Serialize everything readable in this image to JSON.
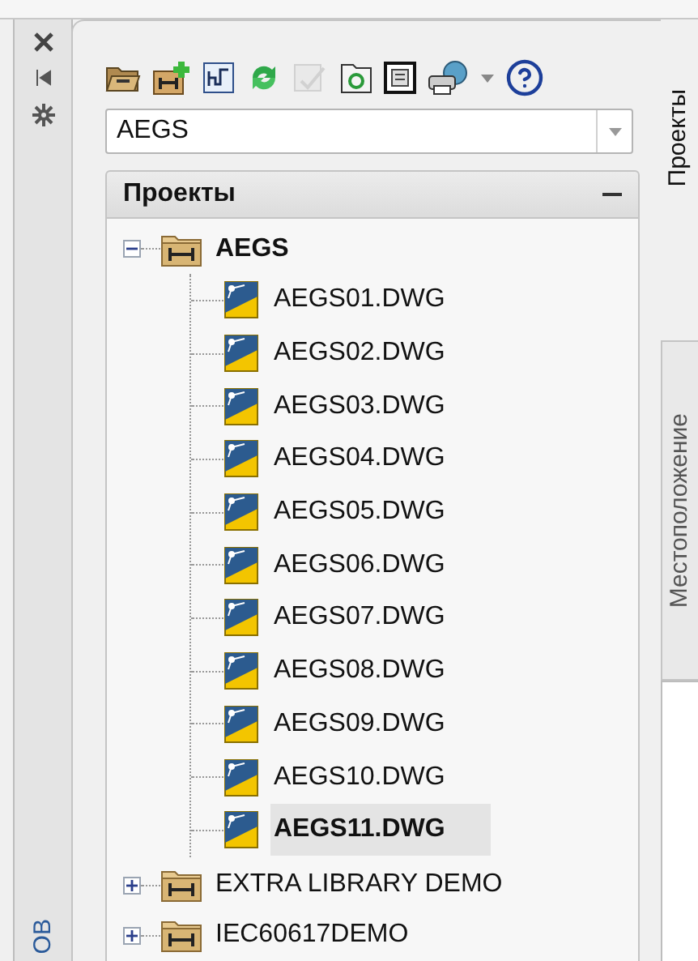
{
  "dock_strip": {
    "label": "ОВ"
  },
  "toolbar": {
    "buttons": [
      {
        "kind": "open-project",
        "disabled": false
      },
      {
        "kind": "new-project",
        "disabled": false
      },
      {
        "kind": "properties",
        "disabled": false
      },
      {
        "kind": "refresh",
        "disabled": false
      },
      {
        "kind": "task-list",
        "disabled": true
      },
      {
        "kind": "folder-refresh",
        "disabled": false
      },
      {
        "kind": "report",
        "disabled": false
      },
      {
        "kind": "publish",
        "disabled": false
      },
      {
        "kind": "dropdown",
        "disabled": false
      },
      {
        "kind": "help",
        "disabled": false
      }
    ]
  },
  "project_combo": {
    "value": "AEGS"
  },
  "section": {
    "title": "Проекты",
    "expanded": true
  },
  "tree": [
    {
      "label": "AEGS",
      "active": true,
      "expanded": true,
      "children": [
        {
          "label": "AEGS01.DWG",
          "selected": false
        },
        {
          "label": "AEGS02.DWG",
          "selected": false
        },
        {
          "label": "AEGS03.DWG",
          "selected": false
        },
        {
          "label": "AEGS04.DWG",
          "selected": false
        },
        {
          "label": "AEGS05.DWG",
          "selected": false
        },
        {
          "label": "AEGS06.DWG",
          "selected": false
        },
        {
          "label": "AEGS07.DWG",
          "selected": false
        },
        {
          "label": "AEGS08.DWG",
          "selected": false
        },
        {
          "label": "AEGS09.DWG",
          "selected": false
        },
        {
          "label": "AEGS10.DWG",
          "selected": false
        },
        {
          "label": "AEGS11.DWG",
          "selected": true
        }
      ]
    },
    {
      "label": "EXTRA LIBRARY DEMO",
      "active": false,
      "expanded": false
    },
    {
      "label": "IEC60617DEMO",
      "active": false,
      "expanded": false
    }
  ],
  "side_tabs": [
    {
      "label": "Проекты",
      "selected": true
    },
    {
      "label": "Местоположение",
      "selected": false
    }
  ]
}
